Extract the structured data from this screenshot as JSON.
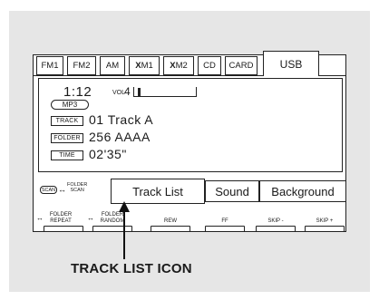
{
  "source_tabs": [
    {
      "label": "FM1"
    },
    {
      "label": "FM2"
    },
    {
      "label": "AM"
    },
    {
      "prefix": "X",
      "label": "M1"
    },
    {
      "prefix": "X",
      "label": "M2"
    },
    {
      "label": "CD"
    },
    {
      "label": "CARD"
    },
    {
      "label": "USB",
      "active": true
    }
  ],
  "display": {
    "time": "1:12",
    "vol_label": "VOL",
    "vol_value": "4",
    "format": "MP3",
    "rows": [
      {
        "label": "TRACK",
        "value": "01  Track A"
      },
      {
        "label": "FOLDER",
        "value": "256  AAAA"
      },
      {
        "label": "TIME",
        "value": "02'35\""
      }
    ]
  },
  "softkeys": {
    "scan_badge": "SCAN",
    "folder_scan": [
      "FOLDER",
      "SCAN"
    ],
    "items": [
      {
        "label": "Track  List",
        "selected": true
      },
      {
        "label": "Sound"
      },
      {
        "label": "Background"
      }
    ]
  },
  "hard_buttons": [
    {
      "label_lines": [
        "FOLDER",
        "REPEAT"
      ]
    },
    {
      "label_lines": [
        "FOLDER",
        "RANDOM"
      ]
    },
    {
      "label_lines": [
        "REW"
      ]
    },
    {
      "label_lines": [
        "FF"
      ]
    },
    {
      "label_lines": [
        "SKIP -"
      ]
    },
    {
      "label_lines": [
        "SKIP +"
      ]
    }
  ],
  "caption": "TRACK LIST ICON"
}
